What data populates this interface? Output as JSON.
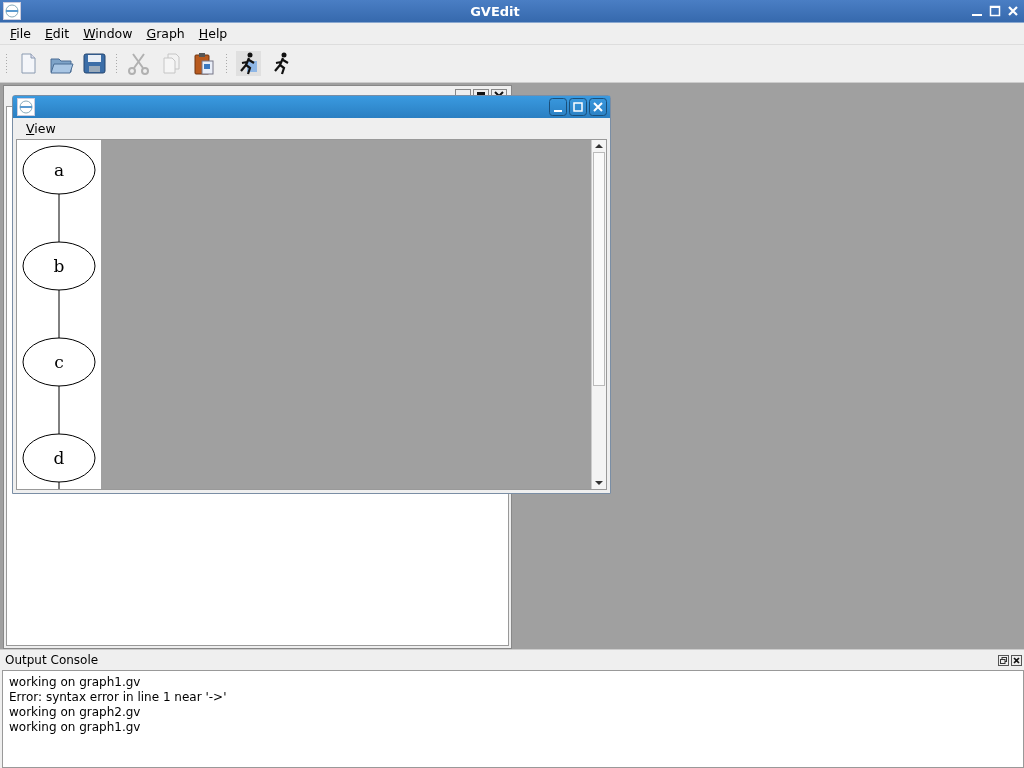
{
  "window": {
    "title": "GVEdit"
  },
  "menu": [
    {
      "label": "File"
    },
    {
      "label": "Edit"
    },
    {
      "label": "Window"
    },
    {
      "label": "Graph"
    },
    {
      "label": "Help"
    }
  ],
  "toolbar": [
    {
      "kind": "new",
      "disabled": false
    },
    {
      "kind": "open",
      "disabled": false
    },
    {
      "kind": "save",
      "disabled": false
    },
    {
      "kind": "sep"
    },
    {
      "kind": "cut",
      "disabled": true
    },
    {
      "kind": "copy",
      "disabled": true
    },
    {
      "kind": "paste",
      "disabled": false
    },
    {
      "kind": "sep"
    },
    {
      "kind": "preview",
      "disabled": false
    },
    {
      "kind": "run",
      "disabled": false
    }
  ],
  "preview_window": {
    "menu": [
      {
        "label": "View"
      }
    ],
    "graph": {
      "nodes": [
        "a",
        "b",
        "c",
        "d"
      ]
    }
  },
  "output_console": {
    "title": "Output Console",
    "lines": [
      "working on graph1.gv",
      "Error: syntax error in line 1 near '->'",
      "working on graph2.gv",
      "working on graph1.gv"
    ]
  }
}
